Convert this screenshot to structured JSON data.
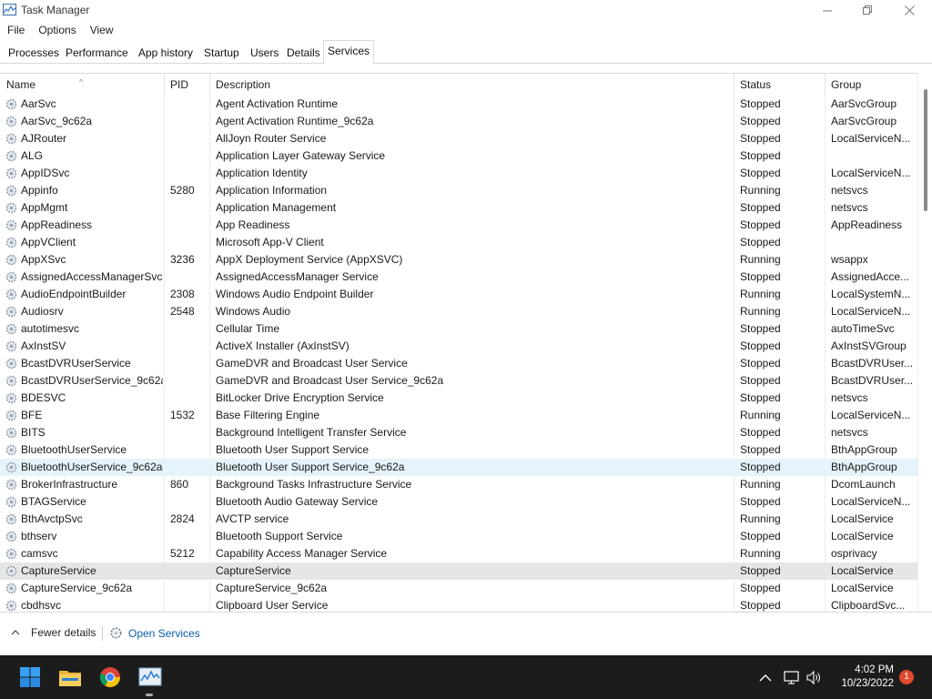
{
  "window": {
    "title": "Task Manager"
  },
  "menu": [
    "File",
    "Options",
    "View"
  ],
  "tabs": [
    "Processes",
    "Performance",
    "App history",
    "Startup",
    "Users",
    "Details",
    "Services"
  ],
  "active_tab": "Services",
  "columns": {
    "name": "Name",
    "pid": "PID",
    "description": "Description",
    "status": "Status",
    "group": "Group"
  },
  "rows": [
    {
      "name": "AarSvc",
      "pid": "",
      "description": "Agent Activation Runtime",
      "status": "Stopped",
      "group": "AarSvcGroup"
    },
    {
      "name": "AarSvc_9c62a",
      "pid": "",
      "description": "Agent Activation Runtime_9c62a",
      "status": "Stopped",
      "group": "AarSvcGroup"
    },
    {
      "name": "AJRouter",
      "pid": "",
      "description": "AllJoyn Router Service",
      "status": "Stopped",
      "group": "LocalServiceN..."
    },
    {
      "name": "ALG",
      "pid": "",
      "description": "Application Layer Gateway Service",
      "status": "Stopped",
      "group": ""
    },
    {
      "name": "AppIDSvc",
      "pid": "",
      "description": "Application Identity",
      "status": "Stopped",
      "group": "LocalServiceN..."
    },
    {
      "name": "Appinfo",
      "pid": "5280",
      "description": "Application Information",
      "status": "Running",
      "group": "netsvcs"
    },
    {
      "name": "AppMgmt",
      "pid": "",
      "description": "Application Management",
      "status": "Stopped",
      "group": "netsvcs"
    },
    {
      "name": "AppReadiness",
      "pid": "",
      "description": "App Readiness",
      "status": "Stopped",
      "group": "AppReadiness"
    },
    {
      "name": "AppVClient",
      "pid": "",
      "description": "Microsoft App-V Client",
      "status": "Stopped",
      "group": ""
    },
    {
      "name": "AppXSvc",
      "pid": "3236",
      "description": "AppX Deployment Service (AppXSVC)",
      "status": "Running",
      "group": "wsappx"
    },
    {
      "name": "AssignedAccessManagerSvc",
      "pid": "",
      "description": "AssignedAccessManager Service",
      "status": "Stopped",
      "group": "AssignedAcce..."
    },
    {
      "name": "AudioEndpointBuilder",
      "pid": "2308",
      "description": "Windows Audio Endpoint Builder",
      "status": "Running",
      "group": "LocalSystemN..."
    },
    {
      "name": "Audiosrv",
      "pid": "2548",
      "description": "Windows Audio",
      "status": "Running",
      "group": "LocalServiceN..."
    },
    {
      "name": "autotimesvc",
      "pid": "",
      "description": "Cellular Time",
      "status": "Stopped",
      "group": "autoTimeSvc"
    },
    {
      "name": "AxInstSV",
      "pid": "",
      "description": "ActiveX Installer (AxInstSV)",
      "status": "Stopped",
      "group": "AxInstSVGroup"
    },
    {
      "name": "BcastDVRUserService",
      "pid": "",
      "description": "GameDVR and Broadcast User Service",
      "status": "Stopped",
      "group": "BcastDVRUser..."
    },
    {
      "name": "BcastDVRUserService_9c62a",
      "pid": "",
      "description": "GameDVR and Broadcast User Service_9c62a",
      "status": "Stopped",
      "group": "BcastDVRUser..."
    },
    {
      "name": "BDESVC",
      "pid": "",
      "description": "BitLocker Drive Encryption Service",
      "status": "Stopped",
      "group": "netsvcs"
    },
    {
      "name": "BFE",
      "pid": "1532",
      "description": "Base Filtering Engine",
      "status": "Running",
      "group": "LocalServiceN..."
    },
    {
      "name": "BITS",
      "pid": "",
      "description": "Background Intelligent Transfer Service",
      "status": "Stopped",
      "group": "netsvcs"
    },
    {
      "name": "BluetoothUserService",
      "pid": "",
      "description": "Bluetooth User Support Service",
      "status": "Stopped",
      "group": "BthAppGroup"
    },
    {
      "name": "BluetoothUserService_9c62a",
      "pid": "",
      "description": "Bluetooth User Support Service_9c62a",
      "status": "Stopped",
      "group": "BthAppGroup"
    },
    {
      "name": "BrokerInfrastructure",
      "pid": "860",
      "description": "Background Tasks Infrastructure Service",
      "status": "Running",
      "group": "DcomLaunch"
    },
    {
      "name": "BTAGService",
      "pid": "",
      "description": "Bluetooth Audio Gateway Service",
      "status": "Stopped",
      "group": "LocalServiceN..."
    },
    {
      "name": "BthAvctpSvc",
      "pid": "2824",
      "description": "AVCTP service",
      "status": "Running",
      "group": "LocalService"
    },
    {
      "name": "bthserv",
      "pid": "",
      "description": "Bluetooth Support Service",
      "status": "Stopped",
      "group": "LocalService"
    },
    {
      "name": "camsvc",
      "pid": "5212",
      "description": "Capability Access Manager Service",
      "status": "Running",
      "group": "osprivacy"
    },
    {
      "name": "CaptureService",
      "pid": "",
      "description": "CaptureService",
      "status": "Stopped",
      "group": "LocalService"
    },
    {
      "name": "CaptureService_9c62a",
      "pid": "",
      "description": "CaptureService_9c62a",
      "status": "Stopped",
      "group": "LocalService"
    },
    {
      "name": "cbdhsvc",
      "pid": "",
      "description": "Clipboard User Service",
      "status": "Stopped",
      "group": "ClipboardSvc..."
    }
  ],
  "selected_row": "CaptureService",
  "hover_row": "BluetoothUserService_9c62a",
  "footer": {
    "fewer_details": "Fewer details",
    "open_services": "Open Services"
  },
  "taskbar": {
    "icons": [
      "windows-start-icon",
      "file-explorer-icon",
      "chrome-icon",
      "task-manager-icon"
    ],
    "time": "4:02 PM",
    "date": "10/23/2022",
    "notification_count": "1"
  },
  "colors": {
    "accent_blue": "#0b5cad",
    "selected_row": "#e6e6e6",
    "hover_row": "#e5f3fb",
    "taskbar": "#1c1c1c",
    "notif_badge": "#e04a2f"
  }
}
